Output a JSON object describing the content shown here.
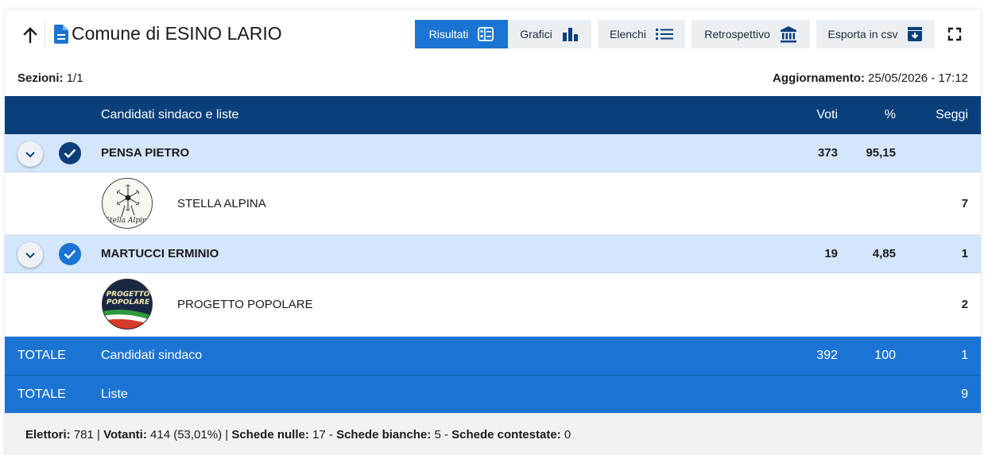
{
  "header": {
    "title": "Comune di ESINO LARIO",
    "buttons": {
      "risultati": "Risultati",
      "grafici": "Grafici",
      "elenchi": "Elenchi",
      "retrospettivo": "Retrospettivo",
      "esporta": "Esporta in csv"
    },
    "icons": [
      "arrow-up-icon",
      "document-icon",
      "table-icon",
      "bar-chart-icon",
      "list-icon",
      "bank-icon",
      "download-box-icon",
      "fullscreen-icon"
    ]
  },
  "meta": {
    "sezioni_label": "Sezioni:",
    "sezioni_value": "1/1",
    "aggiornamento_label": "Aggiornamento:",
    "aggiornamento_value": "25/05/2026 - 17:12"
  },
  "table": {
    "headers": {
      "candidati": "Candidati sindaco e liste",
      "voti": "Voti",
      "perc": "%",
      "seggi": "Seggi"
    },
    "candidates": [
      {
        "name": "PENSA PIETRO",
        "voti": "373",
        "perc": "95,15",
        "seggi": "",
        "check_color": "#0a3f7a",
        "list": {
          "name": "STELLA ALPINA",
          "seggi": "7",
          "logo_text": "Stella Alpina"
        }
      },
      {
        "name": "MARTUCCI ERMINIO",
        "voti": "19",
        "perc": "4,85",
        "seggi": "1",
        "check_color": "#1b74d3",
        "list": {
          "name": "PROGETTO POPOLARE",
          "seggi": "2",
          "logo_line1": "PROGETTO",
          "logo_line2": "POPOLARE"
        }
      }
    ],
    "totals": [
      {
        "label": "TOTALE",
        "desc": "Candidati sindaco",
        "voti": "392",
        "perc": "100",
        "seggi": "1"
      },
      {
        "label": "TOTALE",
        "desc": "Liste",
        "voti": "",
        "perc": "",
        "seggi": "9"
      }
    ]
  },
  "footer": {
    "elettori_label": "Elettori:",
    "elettori_value": "781",
    "votanti_label": "Votanti:",
    "votanti_value": "414 (53,01%)",
    "nulle_label": "Schede nulle:",
    "nulle_value": "17",
    "bianche_label": "Schede bianche:",
    "bianche_value": "5",
    "contestate_label": "Schede contestate:",
    "contestate_value": "0"
  },
  "colors": {
    "header_blue": "#0a3f7a",
    "accent_blue": "#1b74d3",
    "candidate_row": "#d4e6fb",
    "button_gray": "#eceff2"
  }
}
